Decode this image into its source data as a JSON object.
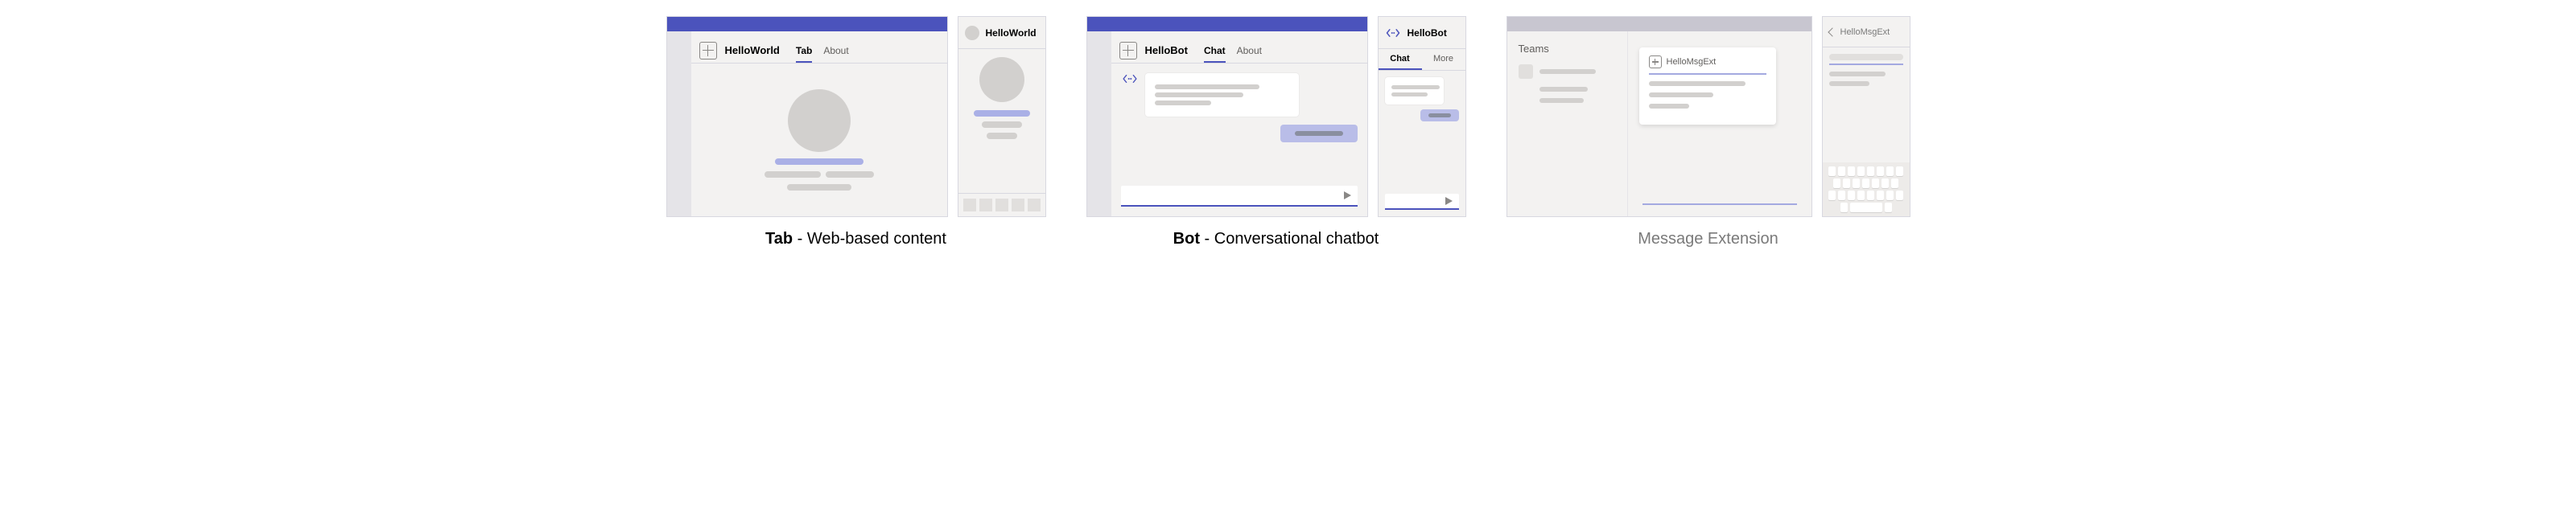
{
  "groups": {
    "tab": {
      "caption_bold": "Tab",
      "caption_rest": " - Web-based content",
      "desktop": {
        "app_title": "HelloWorld",
        "tabs": [
          "Tab",
          "About"
        ],
        "active_tab": "Tab"
      },
      "mobile": {
        "header_title": "HelloWorld"
      }
    },
    "bot": {
      "caption_bold": "Bot",
      "caption_rest": " - Conversational chatbot",
      "desktop": {
        "app_title": "HelloBot",
        "tabs": [
          "Chat",
          "About"
        ],
        "active_tab": "Chat"
      },
      "mobile": {
        "header_title": "HelloBot",
        "tabs": [
          "Chat",
          "More"
        ],
        "active_tab": "Chat"
      }
    },
    "mex": {
      "caption": "Message Extension",
      "desktop": {
        "sidebar_title": "Teams",
        "card_title": "HelloMsgExt"
      },
      "mobile": {
        "header_title": "HelloMsgExt"
      }
    }
  },
  "colors": {
    "brand": "#4b53bc",
    "brand_light": "#aab0e6",
    "grey_titlebar": "#c8c6d0",
    "grey_bg": "#f3f2f1",
    "grey_ph": "#d2d0ce"
  }
}
